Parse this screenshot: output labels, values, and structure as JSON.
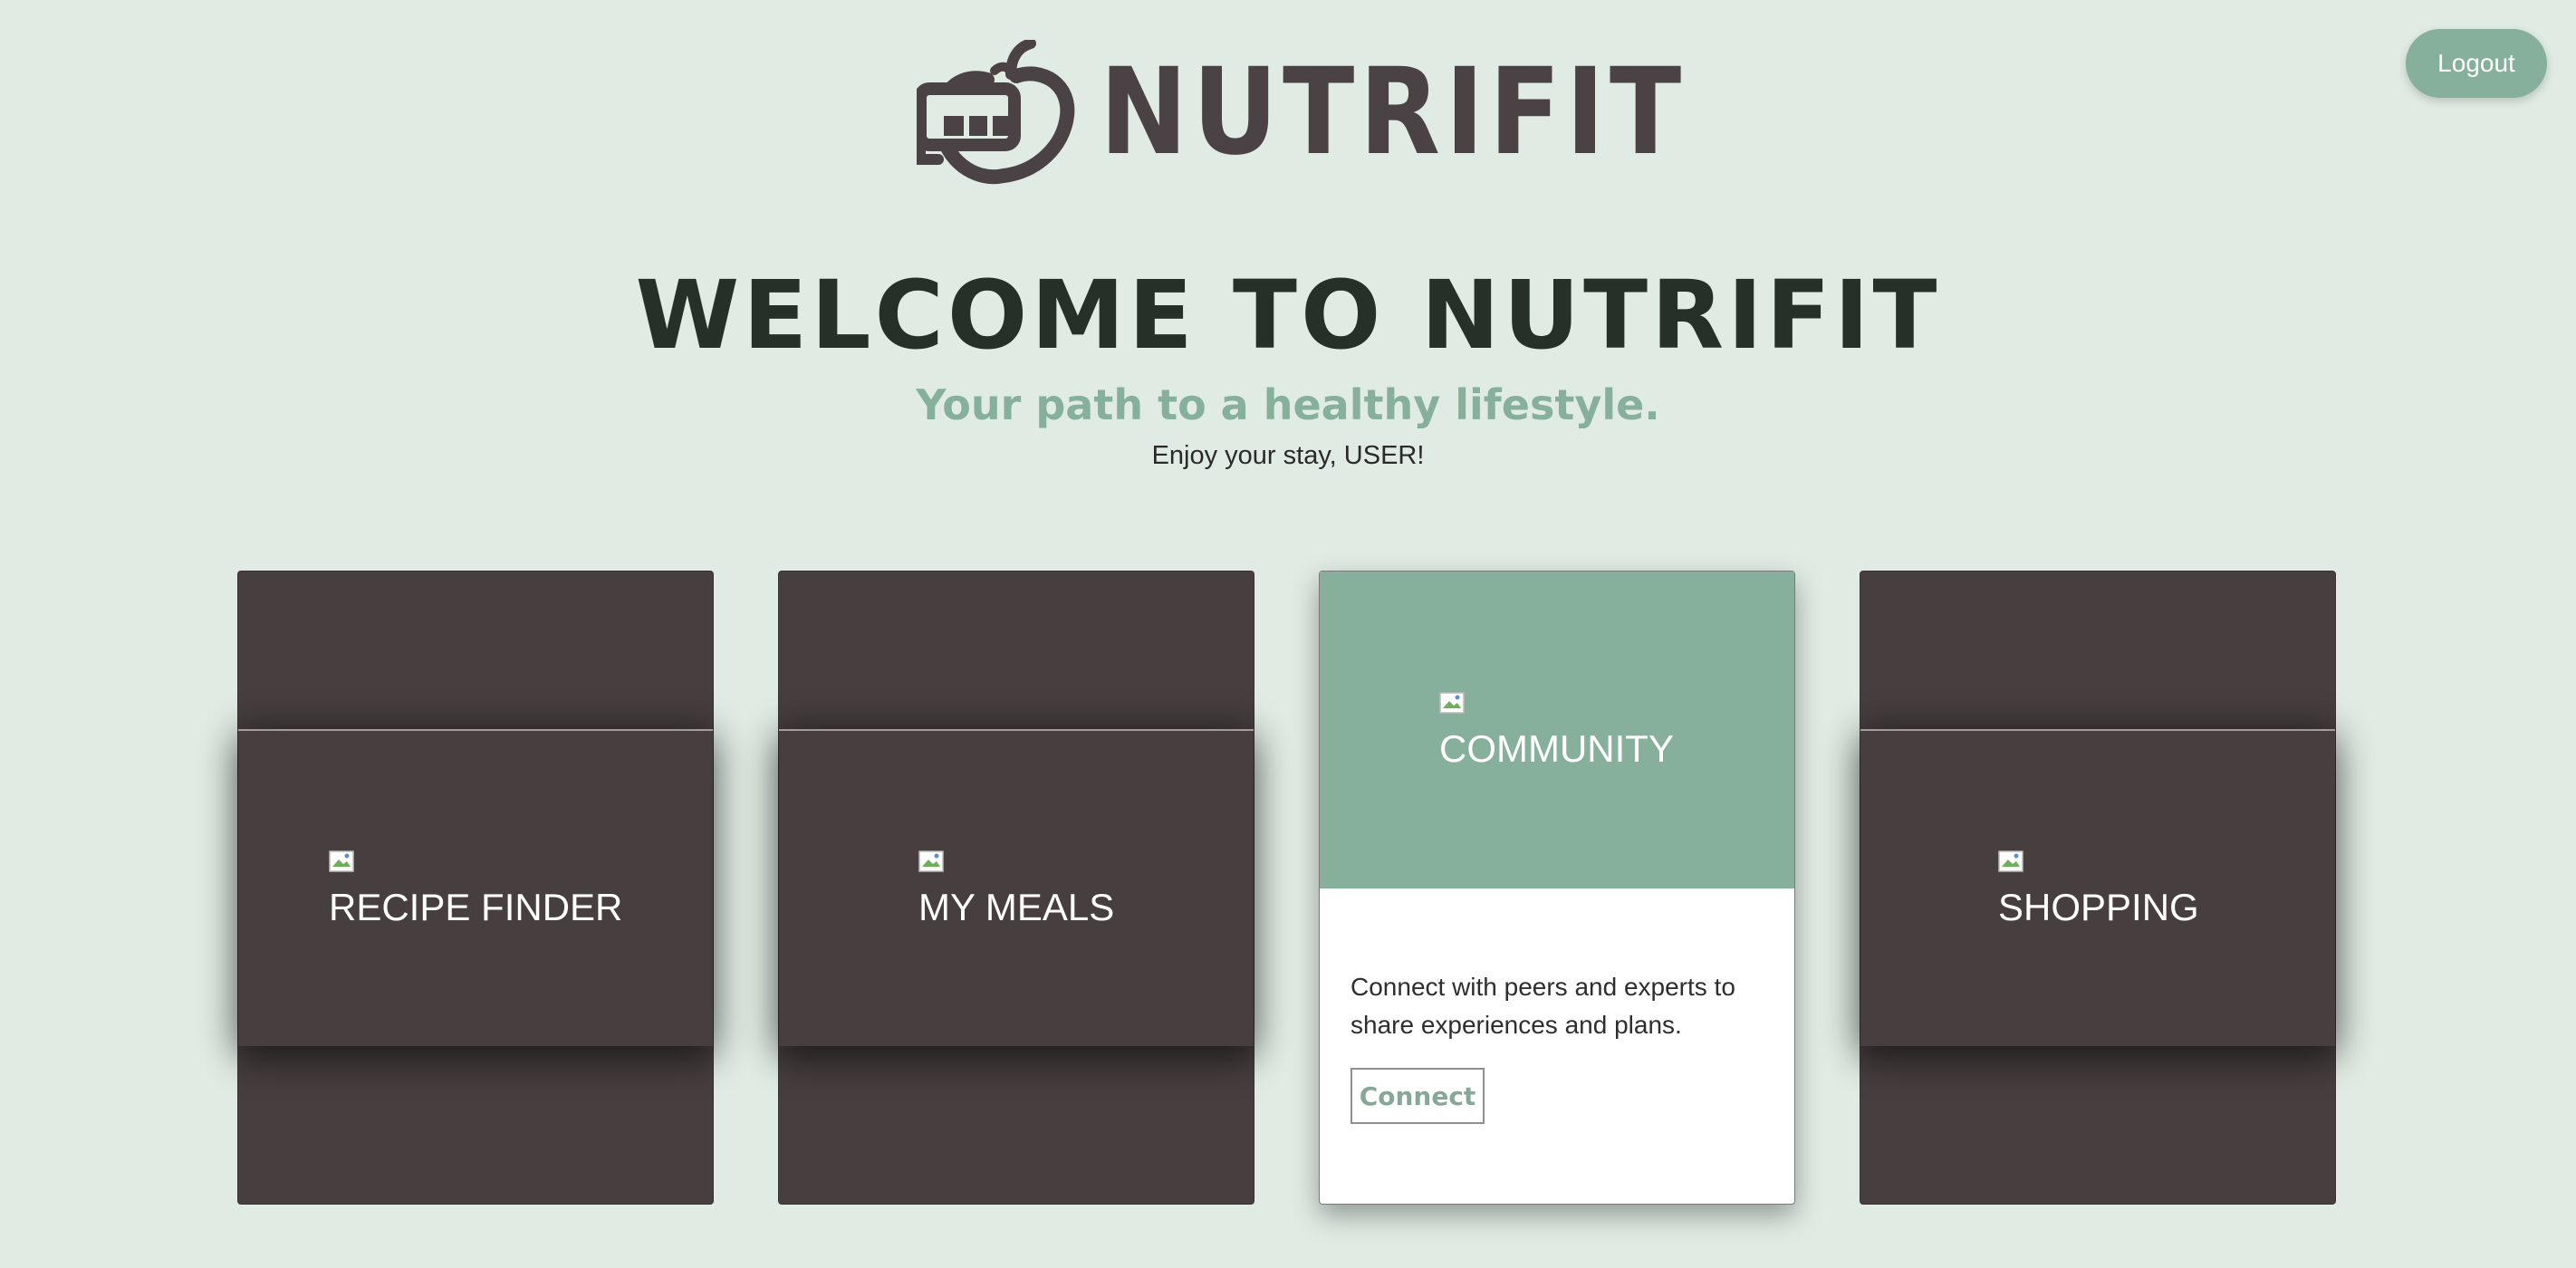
{
  "header": {
    "logout_label": "Logout",
    "logo_text": "NUTRIFIT"
  },
  "hero": {
    "title": "WELCOME TO NUTRIFIT",
    "tagline": "Your path to a healthy lifestyle.",
    "greeting": "Enjoy your stay, USER!"
  },
  "cards": [
    {
      "title": "RECIPE FINDER"
    },
    {
      "title": "MY MEALS"
    },
    {
      "title": "COMMUNITY",
      "description": "Connect with peers and experts to share experiences and plans.",
      "button_label": "Connect"
    },
    {
      "title": "SHOPPING"
    }
  ],
  "colors": {
    "background": "#e0ece3",
    "accent_green": "#86b09b",
    "card_dark": "#463e3f",
    "logo_dark": "#4a4244",
    "title_dark": "#263028"
  },
  "icons": {
    "logo": "apple-truck-logo-icon",
    "card_image": "broken-image-icon"
  }
}
